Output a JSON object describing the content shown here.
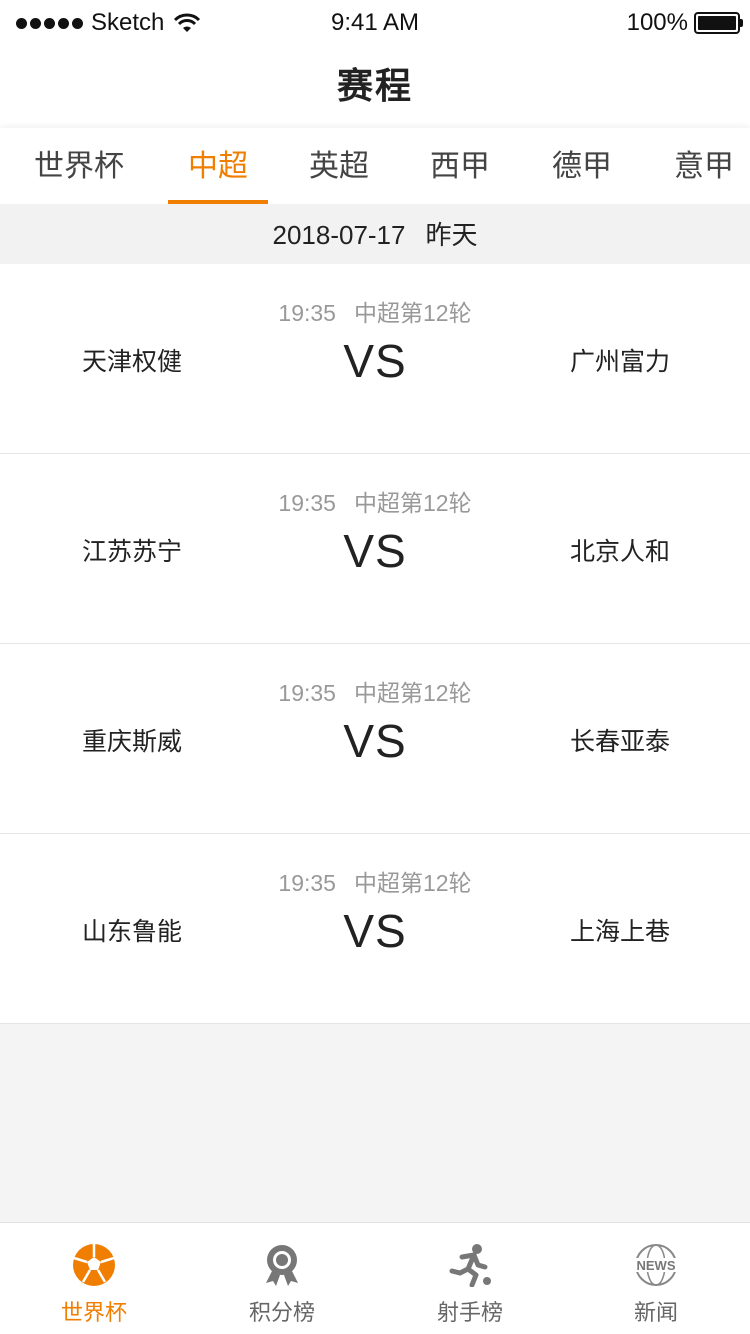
{
  "status_bar": {
    "carrier": "Sketch",
    "time": "9:41 AM",
    "battery": "100%"
  },
  "nav": {
    "title": "赛程"
  },
  "tabs": [
    {
      "label": "世界杯",
      "active": false
    },
    {
      "label": "中超",
      "active": true
    },
    {
      "label": "英超",
      "active": false
    },
    {
      "label": "西甲",
      "active": false
    },
    {
      "label": "德甲",
      "active": false
    },
    {
      "label": "意甲",
      "active": false
    }
  ],
  "date_header": {
    "date": "2018-07-17",
    "relative": "昨天"
  },
  "matches": [
    {
      "time": "19:35",
      "round": "中超第12轮",
      "home": "天津权健",
      "vs": "VS",
      "away": "广州富力"
    },
    {
      "time": "19:35",
      "round": "中超第12轮",
      "home": "江苏苏宁",
      "vs": "VS",
      "away": "北京人和"
    },
    {
      "time": "19:35",
      "round": "中超第12轮",
      "home": "重庆斯威",
      "vs": "VS",
      "away": "长春亚泰"
    },
    {
      "time": "19:35",
      "round": "中超第12轮",
      "home": "山东鲁能",
      "vs": "VS",
      "away": "上海上巷"
    }
  ],
  "tabbar": [
    {
      "label": "世界杯",
      "icon": "soccer-ball-icon",
      "active": true
    },
    {
      "label": "积分榜",
      "icon": "medal-icon",
      "active": false
    },
    {
      "label": "射手榜",
      "icon": "runner-icon",
      "active": false
    },
    {
      "label": "新闻",
      "icon": "news-globe-icon",
      "active": false,
      "icon_text": "NEWS"
    }
  ],
  "colors": {
    "accent": "#f07e00",
    "text": "#222222",
    "muted": "#999999",
    "background": "#f4f4f4"
  }
}
